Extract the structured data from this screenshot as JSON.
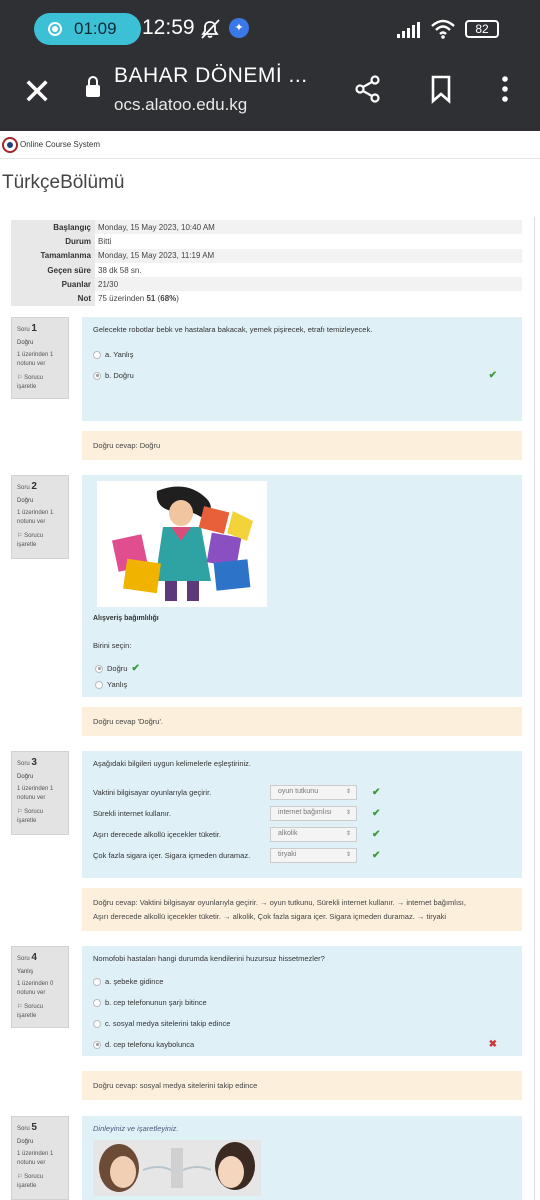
{
  "status_bar": {
    "recording_time": "01:09",
    "clock": "12:59",
    "battery": "82"
  },
  "browser": {
    "page_title": "BAHAR DÖNEMİ ...",
    "host": "ocs.alatoo.edu.kg"
  },
  "site": {
    "name": "Online Course System"
  },
  "course_title": "TürkçeBölümü",
  "summary": [
    {
      "label": "Başlangıç",
      "value": "Monday, 15 May 2023, 10:40 AM"
    },
    {
      "label": "Durum",
      "value": "Bitti"
    },
    {
      "label": "Tamamlanma",
      "value": "Monday, 15 May 2023, 11:19 AM"
    },
    {
      "label": "Geçen süre",
      "value": "38 dk 58 sn."
    },
    {
      "label": "Puanlar",
      "value": "21/30"
    },
    {
      "label": "Not",
      "value_prefix": "75 üzerinden ",
      "value_bold": "51",
      "value_suffix": " (",
      "value_pct": "68%",
      "value_end": ")"
    }
  ],
  "question_prefix": "Soru",
  "flag_label": "Sorucu işaretle",
  "questions": [
    {
      "number": "1",
      "state": "Doğru",
      "grade": "1 üzerinden 1 notunu ver",
      "text": "Gelecekte robotlar bebk ve hastalara bakacak, yemek pişirecek, etrafı temizleyecek.",
      "options": [
        "a. Yanlış",
        "b. Doğru"
      ],
      "feedback": "Doğru cevap: Doğru"
    },
    {
      "number": "2",
      "state": "Doğru",
      "grade": "1 üzerinden 1 notunu ver",
      "caption": "Alışveriş bağımlılığı",
      "prompt": "Birini seçin:",
      "options": [
        "Doğru",
        "Yanlış"
      ],
      "feedback": "Doğru cevap 'Doğru'."
    },
    {
      "number": "3",
      "state": "Doğru",
      "grade": "1 üzerinden 1 notunu ver",
      "text": "Aşağıdaki bilgileri uygun kelimelerle eşleştiriniz.",
      "rows": [
        {
          "stem": "Vaktini bilgisayar oyunlarıyla geçirir.",
          "answer": "oyun tutkunu"
        },
        {
          "stem": "Sürekli internet kullanır.",
          "answer": "internet bağımlısı"
        },
        {
          "stem": "Aşırı derecede alkollü içecekler tüketir.",
          "answer": "alkolik"
        },
        {
          "stem": "Çok fazla sigara içer. Sigara içmeden duramaz.",
          "answer": "tiryaki"
        }
      ],
      "feedback_line1": "Doğru cevap: Vaktini bilgisayar oyunlarıyla geçirir. → oyun tutkunu, Sürekli internet kullanır. → internet bağımlısı,",
      "feedback_line2": "Aşırı derecede alkollü içecekler tüketir. → alkolik, Çok fazla sigara içer. Sigara içmeden duramaz. → tiryaki"
    },
    {
      "number": "4",
      "state": "Yanlış",
      "grade": "1 üzerinden 0 notunu ver",
      "text": "Nomofobi hastaları hangi durumda kendilerini huzursuz hissetmezler?",
      "options": [
        "a. şebeke gidince",
        "b. cep telefonunun şarjı bitince",
        "c. sosyal medya sitelerini takip edince",
        "d. cep telefonu kaybolunca"
      ],
      "feedback": "Doğru cevap: sosyal medya sitelerini takip edince"
    },
    {
      "number": "5",
      "state": "Doğru",
      "grade": "1 üzerinden 1 notunu ver",
      "text": "Dinleyiniz ve işaretleyiniz."
    }
  ],
  "colors": {
    "question_bg": "#dff0f7",
    "feedback_bg": "#fcefdc",
    "correct": "#3c9a3c",
    "wrong": "#c93a3a",
    "status_bar": "#2f3033",
    "record_pill": "#3cc0d6"
  },
  "icons": [
    "record-icon",
    "mute-icon",
    "app-badge-icon",
    "signal-icon",
    "wifi-icon",
    "battery-icon",
    "close-icon",
    "lock-icon",
    "share-icon",
    "bookmark-icon",
    "more-icon",
    "flag-icon",
    "check-icon",
    "cross-icon"
  ]
}
